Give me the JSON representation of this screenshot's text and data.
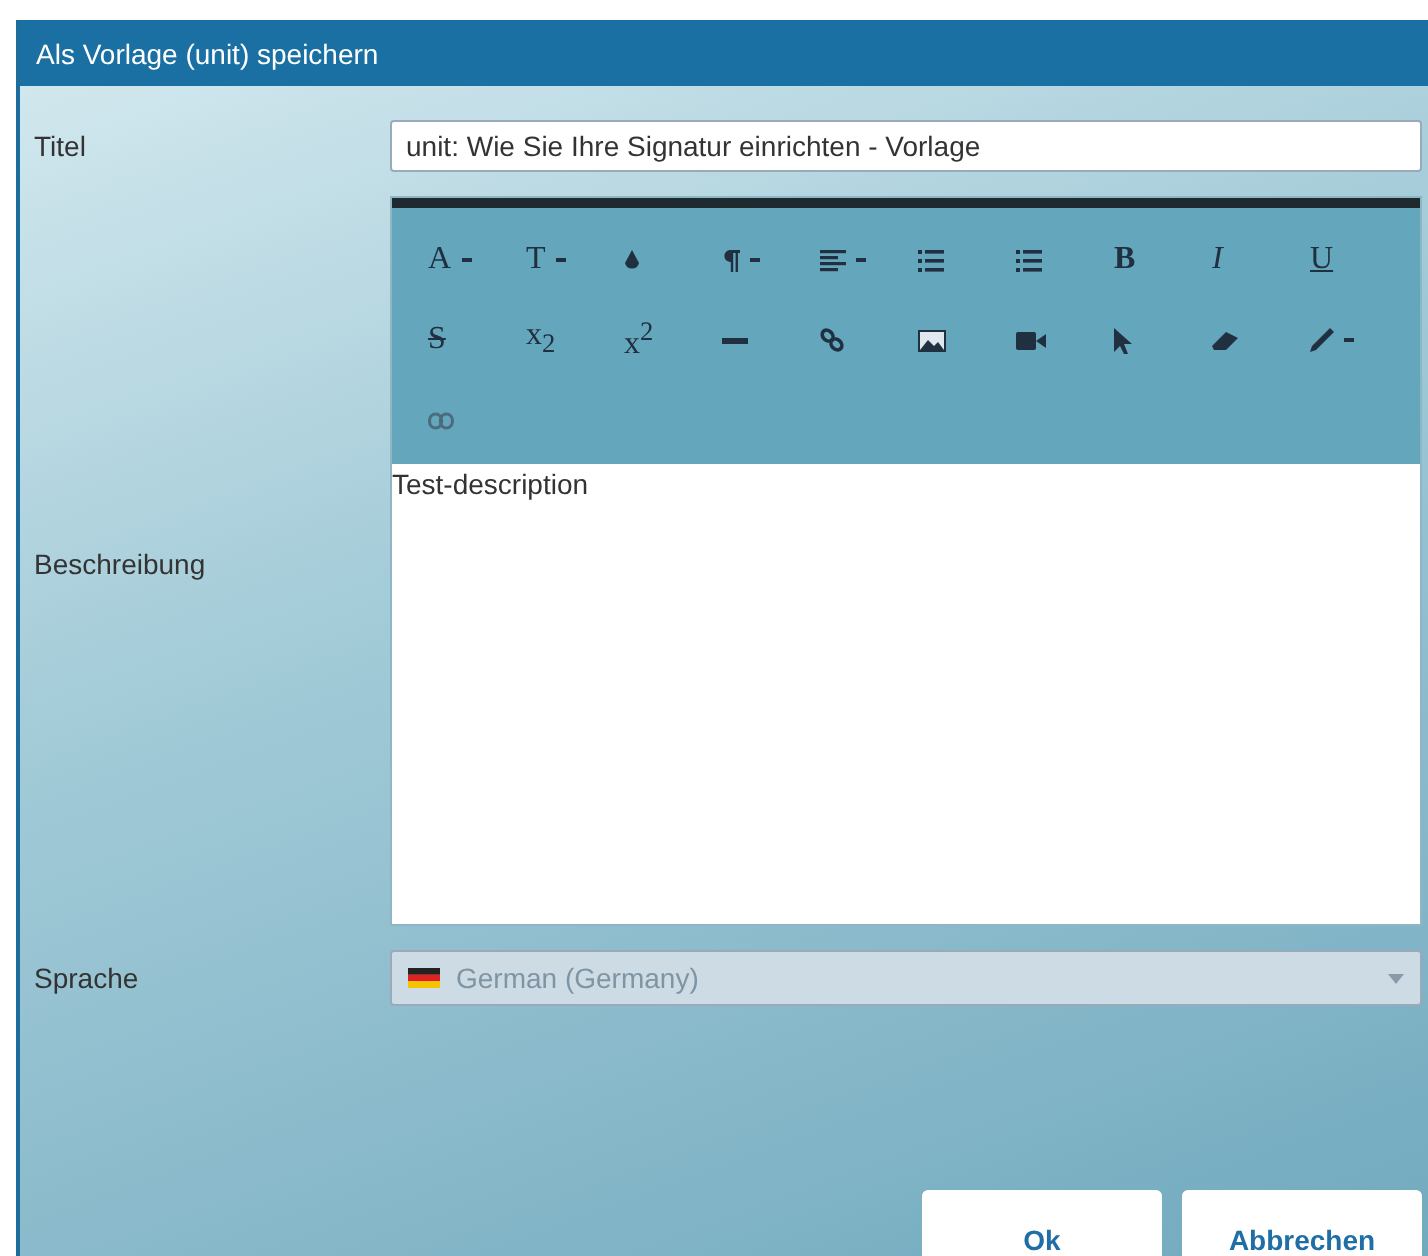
{
  "dialog": {
    "title": "Als Vorlage (unit) speichern"
  },
  "fields": {
    "title": {
      "label": "Titel",
      "value": "unit: Wie Sie Ihre Signatur einrichten - Vorlage"
    },
    "description": {
      "label": "Beschreibung",
      "value": "Test-description",
      "toolbar": [
        {
          "kind": "glyph",
          "label": "A",
          "dropdown": true
        },
        {
          "kind": "glyph",
          "label": "T",
          "dropdown": true
        },
        {
          "kind": "color",
          "dropdown": false
        },
        {
          "kind": "paragraph",
          "dropdown": true
        },
        {
          "kind": "align",
          "dropdown": true
        },
        {
          "kind": "ordered-list",
          "dropdown": false
        },
        {
          "kind": "bullet-list",
          "dropdown": false
        },
        {
          "kind": "glyph",
          "label": "B",
          "dropdown": false
        },
        {
          "kind": "glyph",
          "label": "I",
          "dropdown": false
        },
        {
          "kind": "glyph",
          "label": "U",
          "dropdown": false
        },
        {
          "kind": "glyph",
          "label": "S",
          "dropdown": false
        },
        {
          "kind": "glyph",
          "label": "x$_{2}$",
          "dropdown": false
        },
        {
          "kind": "glyph",
          "label": "x$^{2}$",
          "dropdown": false
        },
        {
          "kind": "rule",
          "dropdown": false
        },
        {
          "kind": "link",
          "dropdown": false
        },
        {
          "kind": "image",
          "dropdown": false
        },
        {
          "kind": "video",
          "dropdown": false
        },
        {
          "kind": "pointer",
          "dropdown": false
        },
        {
          "kind": "eraser",
          "dropdown": false
        },
        {
          "kind": "pen",
          "dropdown": true
        },
        {
          "kind": "unlink",
          "dropdown": false
        }
      ]
    },
    "language": {
      "label": "Sprache",
      "value": "German (Germany)",
      "disabled": true
    }
  },
  "buttons": [
    {
      "label": "Ok"
    },
    {
      "label": "Abbrechen"
    }
  ]
}
